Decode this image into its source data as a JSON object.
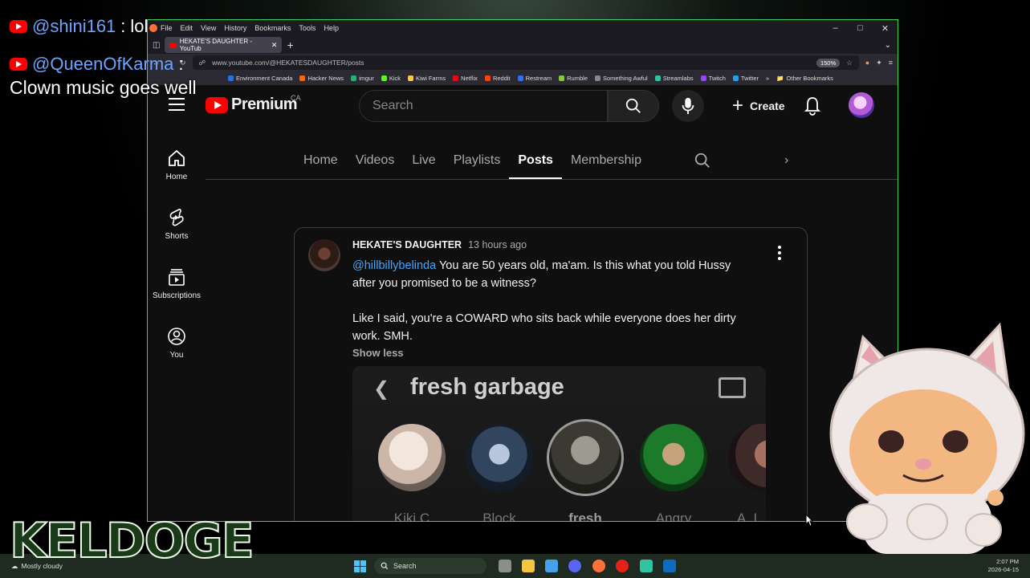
{
  "overlay": {
    "chat": [
      {
        "user": "@shini161",
        "sep": ":",
        "message": "lol"
      },
      {
        "user": "@QueenOfKarma",
        "sep": ":",
        "message": ""
      }
    ],
    "chat_message_text": "Clown music goes well",
    "watermark": "KELDOGE"
  },
  "browser": {
    "menu": [
      "File",
      "Edit",
      "View",
      "History",
      "Bookmarks",
      "Tools",
      "Help"
    ],
    "tab_title": "HEKATE'S DAUGHTER - YouTub",
    "url": "www.youtube.com/@HEKATESDAUGHTER/posts",
    "zoom": "150%",
    "bookmarks": [
      {
        "label": "Environment Canada",
        "color": "#2a6ee0"
      },
      {
        "label": "Hacker News",
        "color": "#ff6600"
      },
      {
        "label": "imgur",
        "color": "#1bb76e"
      },
      {
        "label": "Kick",
        "color": "#53fc18"
      },
      {
        "label": "Kiwi Farms",
        "color": "#f2c94c"
      },
      {
        "label": "Netflix",
        "color": "#e50914"
      },
      {
        "label": "Reddit",
        "color": "#ff4500"
      },
      {
        "label": "Restream",
        "color": "#2f6ff5"
      },
      {
        "label": "Rumble",
        "color": "#85c742"
      },
      {
        "label": "Something Awful",
        "color": "#888888"
      },
      {
        "label": "Streamlabs",
        "color": "#31c3a2"
      },
      {
        "label": "Twitch",
        "color": "#9146ff"
      },
      {
        "label": "Twitter",
        "color": "#1da1f2"
      }
    ],
    "other_bookmarks": "Other Bookmarks"
  },
  "youtube": {
    "logo_text": "Premium",
    "country": "CA",
    "search_placeholder": "Search",
    "create_label": "Create",
    "sidenav": [
      {
        "label": "Home",
        "icon": "home-icon"
      },
      {
        "label": "Shorts",
        "icon": "shorts-icon"
      },
      {
        "label": "Subscriptions",
        "icon": "subscriptions-icon"
      },
      {
        "label": "You",
        "icon": "you-icon"
      }
    ],
    "channel_tabs": [
      "Home",
      "Videos",
      "Live",
      "Playlists",
      "Posts",
      "Membership"
    ],
    "active_tab": "Posts",
    "post": {
      "author": "HEKATE'S DAUGHTER",
      "time": "13 hours ago",
      "mention": "@hillbillybelinda",
      "text_line1": " You are 50 years old, ma'am. Is this what you told Hussy after you promised to be a witness?",
      "text_line2": "Like I said, you're a COWARD who sits back while everyone does her dirty work. SMH.",
      "show_less": "Show less",
      "embed": {
        "title": "fresh garbage",
        "labels": [
          "Kiki C",
          "Block",
          "fresh",
          "Angry",
          "A_L"
        ]
      }
    }
  },
  "taskbar": {
    "weather": "Mostly cloudy",
    "search": "Search",
    "time": "2:07 PM",
    "date": "2026-04-15"
  }
}
